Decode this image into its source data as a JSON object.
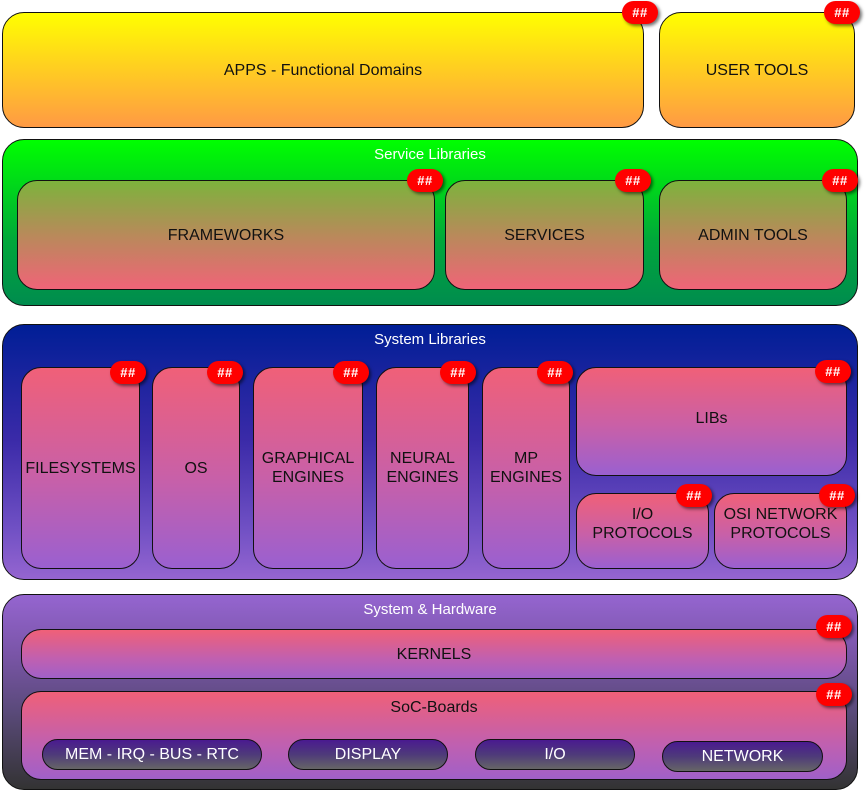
{
  "badge_text": "##",
  "apps": {
    "label": "APPS - Functional Domains"
  },
  "user_tools": {
    "label": "USER TOOLS"
  },
  "service_libraries": {
    "title": "Service Libraries",
    "items": [
      {
        "label": "FRAMEWORKS"
      },
      {
        "label": "SERVICES"
      },
      {
        "label": "ADMIN TOOLS"
      }
    ]
  },
  "system_libraries": {
    "title": "System Libraries",
    "items": [
      {
        "label": "FILESYSTEMS"
      },
      {
        "label": "OS"
      },
      {
        "label": "GRAPHICAL\nENGINES"
      },
      {
        "label": "NEURAL\nENGINES"
      },
      {
        "label": "MP\nENGINES"
      },
      {
        "label": "LIBs"
      },
      {
        "label": "I/O\nPROTOCOLS"
      },
      {
        "label": "OSI NETWORK\nPROTOCOLS"
      }
    ]
  },
  "system_hardware": {
    "title": "System & Hardware",
    "kernels": {
      "label": "KERNELS"
    },
    "soc_boards": {
      "label": "SoC-Boards",
      "chips": [
        {
          "label": "MEM - IRQ - BUS - RTC"
        },
        {
          "label": "DISPLAY"
        },
        {
          "label": "I/O"
        },
        {
          "label": "NETWORK"
        }
      ]
    }
  },
  "colors": {
    "badge": "#ff0000",
    "apps_top": "#ffff00",
    "apps_bottom": "#ff9a44",
    "service_container": "#00ff00",
    "system_libraries_container": "#001e96",
    "item_pink": "#f06078",
    "item_purple": "#9a60d0",
    "chip": "#4a1a90"
  }
}
